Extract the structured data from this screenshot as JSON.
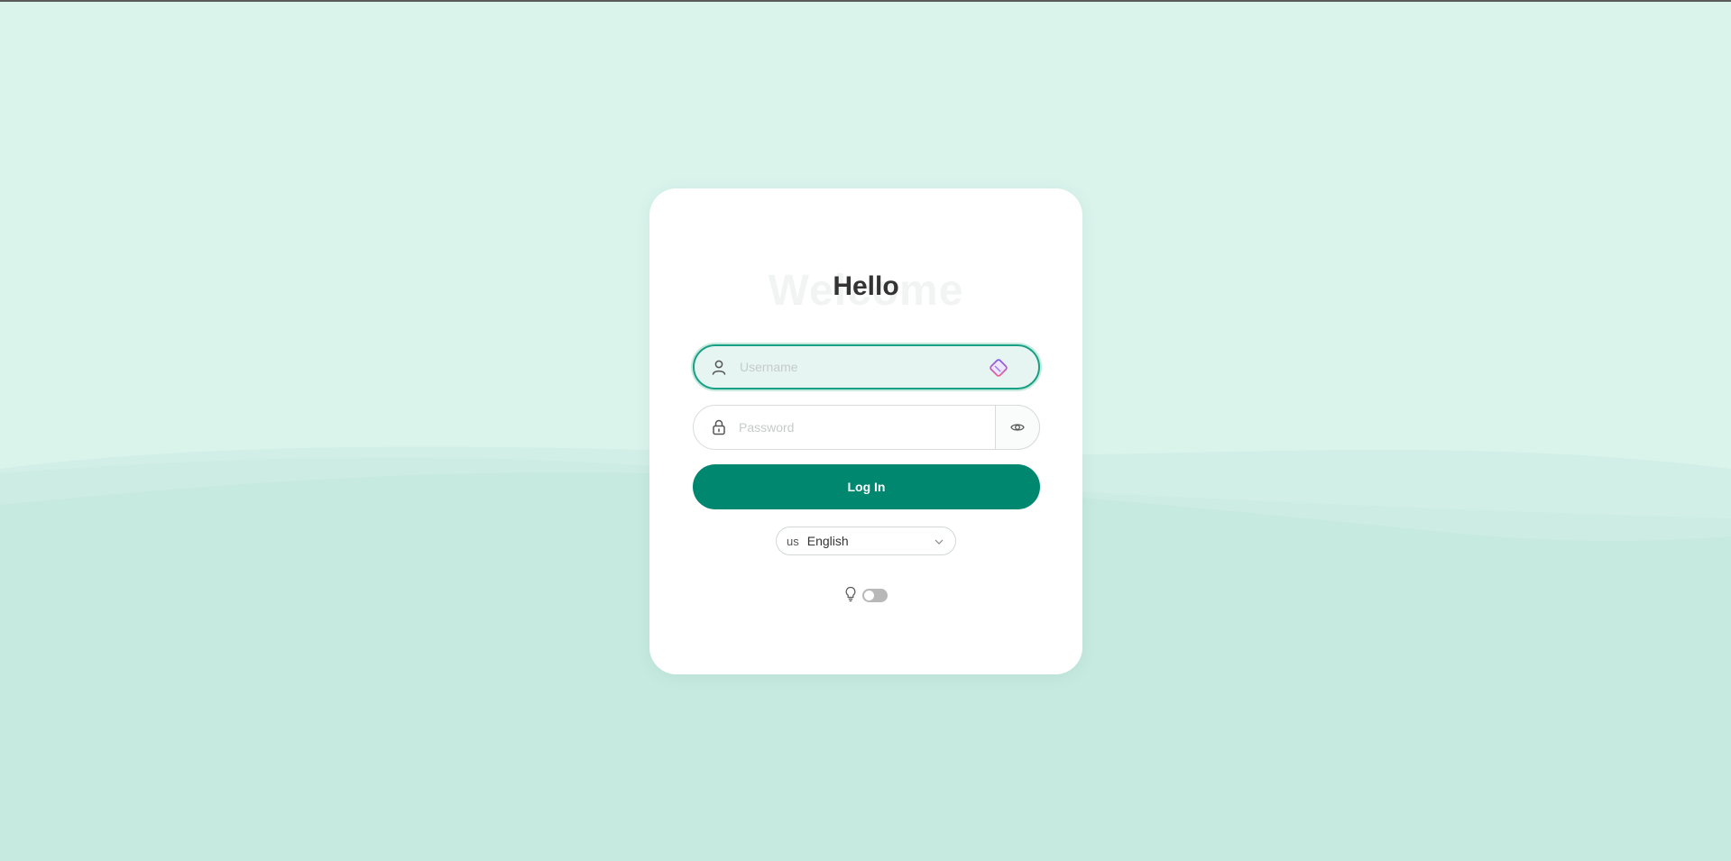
{
  "login": {
    "title_background": "Welcome",
    "title": "Hello",
    "username_placeholder": "Username",
    "password_placeholder": "Password",
    "submit_label": "Log In"
  },
  "language": {
    "flag": "us",
    "selected": "English"
  },
  "theme": {
    "icon": "lightbulb-icon",
    "dark_mode_on": false
  },
  "colors": {
    "primary": "#00876f",
    "page_background": "#daf4ec",
    "wave": "#c6eae0",
    "focus_border": "#17a085"
  }
}
